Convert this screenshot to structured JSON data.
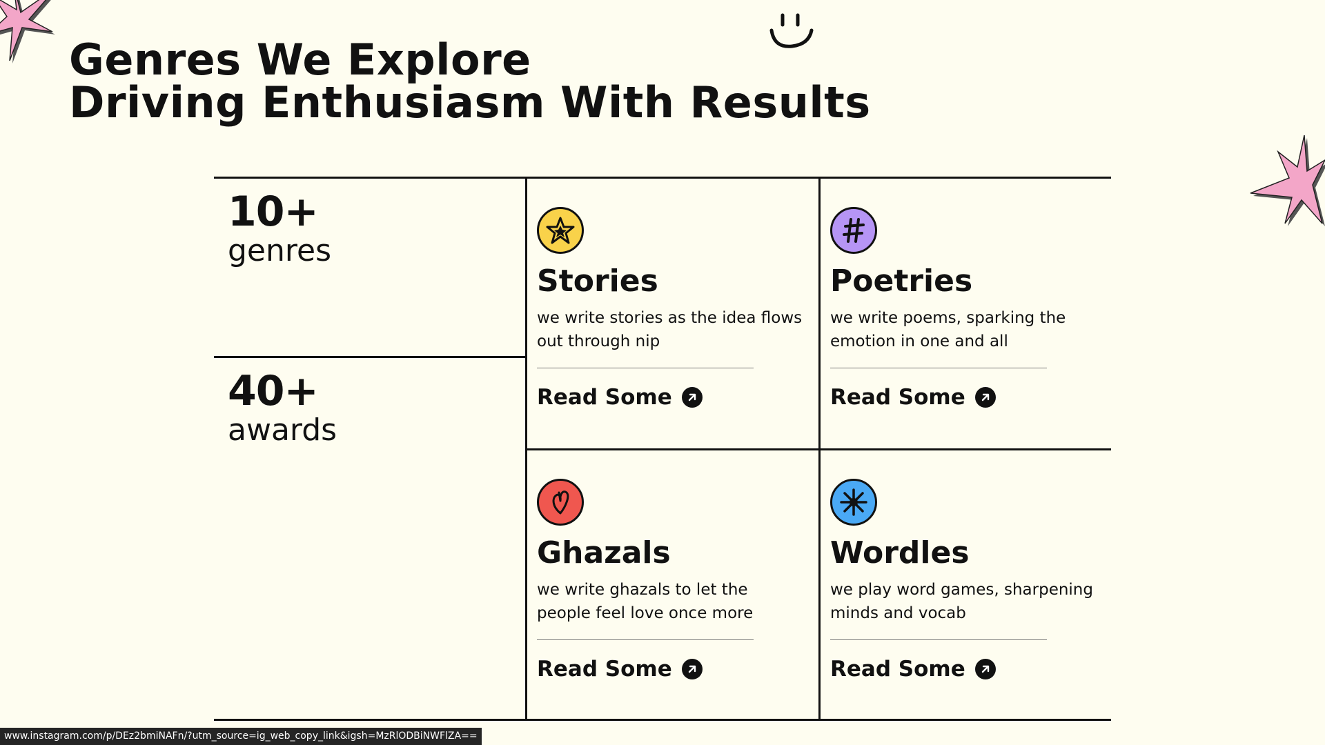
{
  "heading": {
    "line1": "Genres We Explore",
    "line2": "Driving Enthusiasm With Results"
  },
  "stats": [
    {
      "number": "10+",
      "label": "genres"
    },
    {
      "number": "40+",
      "label": "awards"
    }
  ],
  "cards": [
    {
      "title": "Stories",
      "description": "we write stories as the idea flows out through nip",
      "link_label": "Read Some",
      "icon": "star-icon",
      "icon_color": "#f9d24a"
    },
    {
      "title": "Poetries",
      "description": "we write poems, sparking the emotion in one and all",
      "link_label": "Read Some",
      "icon": "hashtag-icon",
      "icon_color": "#b695f5"
    },
    {
      "title": "Ghazals",
      "description": "we write ghazals to let the people feel love once more",
      "link_label": "Read Some",
      "icon": "heart-icon",
      "icon_color": "#f0574f"
    },
    {
      "title": "Wordles",
      "description": "we play word games, sharpening minds and vocab",
      "link_label": "Read Some",
      "icon": "sparkle-icon",
      "icon_color": "#4aa9f5"
    }
  ],
  "status_bar": {
    "url": "www.instagram.com/p/DEz2bmiNAFn/?utm_source=ig_web_copy_link&igsh=MzRlODBiNWFlZA=="
  },
  "colors": {
    "background": "#fefdf0",
    "star_decoration": "#f3a6c8",
    "text": "#111111"
  }
}
